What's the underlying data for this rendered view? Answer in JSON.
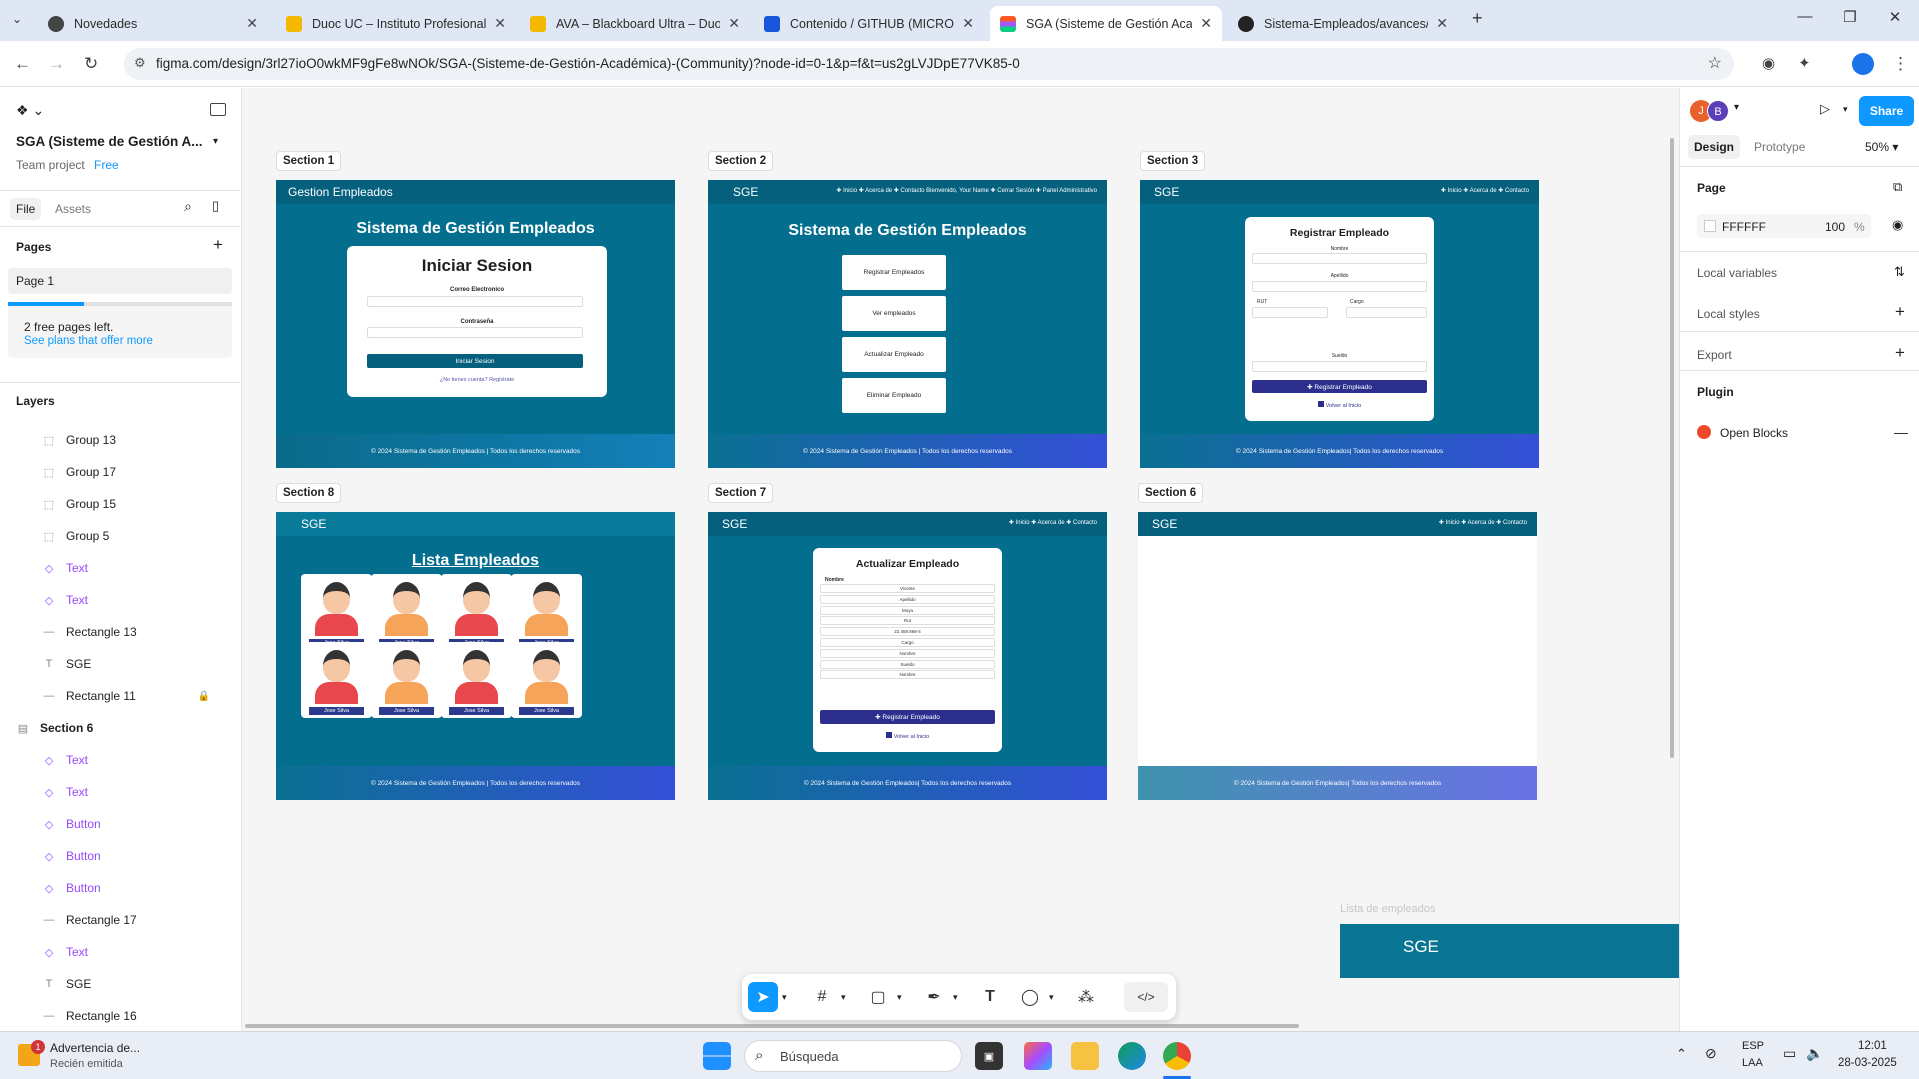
{
  "browser": {
    "tabs": [
      {
        "title": "Novedades",
        "color": "#444"
      },
      {
        "title": "Duoc UC – Instituto Profesional",
        "color": "#f5b800"
      },
      {
        "title": "AVA – Blackboard Ultra – Duoc",
        "color": "#f5b800"
      },
      {
        "title": "Contenido / GITHUB (MICROSC",
        "color": "#1a56db"
      },
      {
        "title": "SGA (Sisteme de Gestión Acad",
        "color": "#ff5722"
      },
      {
        "title": "Sistema-Empleados/avances/se",
        "color": "#222"
      }
    ],
    "url": "figma.com/design/3rl27ioO0wkMF9gFe8wNOk/SGA-(Sisteme-de-Gestión-Académica)-(Community)?node-id=0-1&p=f&t=us2gLVJDpE77VK85-0"
  },
  "left_panel": {
    "project_title": "SGA (Sisteme de Gestión A...",
    "team": "Team project",
    "plan": "Free",
    "tab_file": "File",
    "tab_assets": "Assets",
    "pages_label": "Pages",
    "current_page": "Page 1",
    "free_pages_note": "2 free pages left.",
    "see_plans": "See plans that offer more",
    "layers_label": "Layers",
    "layers": [
      {
        "name": "Group 13",
        "kind": "group"
      },
      {
        "name": "Group 17",
        "kind": "group"
      },
      {
        "name": "Group 15",
        "kind": "group"
      },
      {
        "name": "Group 5",
        "kind": "group"
      },
      {
        "name": "Text",
        "kind": "component"
      },
      {
        "name": "Text",
        "kind": "component"
      },
      {
        "name": "Rectangle 13",
        "kind": "rect"
      },
      {
        "name": "SGE",
        "kind": "text"
      },
      {
        "name": "Rectangle 11",
        "kind": "rect"
      },
      {
        "name": "Section 6",
        "kind": "section"
      },
      {
        "name": "Text",
        "kind": "component"
      },
      {
        "name": "Text",
        "kind": "component"
      },
      {
        "name": "Button",
        "kind": "component"
      },
      {
        "name": "Button",
        "kind": "component"
      },
      {
        "name": "Button",
        "kind": "component"
      },
      {
        "name": "Rectangle 17",
        "kind": "rect"
      },
      {
        "name": "Text",
        "kind": "component"
      },
      {
        "name": "SGE",
        "kind": "text"
      },
      {
        "name": "Rectangle 16",
        "kind": "rect"
      }
    ]
  },
  "canvas": {
    "sections": {
      "s1": "Section 1",
      "s2": "Section 2",
      "s3": "Section 3",
      "s8": "Section 8",
      "s7": "Section 7",
      "s6": "Section 6"
    },
    "footer_text": "© 2024 Sistema de Gestión Empleados | Todos los derechos reservados",
    "footer_text_b": "© 2024 Sistema de Gestión Empleados| Todos los derechos reservados",
    "brand": "SGE",
    "nav_short": "✚ Inicio   ✚ Acerca de   ✚ Contacto",
    "s1": {
      "header": "Gestion Empleados",
      "title": "Sistema de Gestión Empleados",
      "card_title": "Iniciar Sesion",
      "email_label": "Correo Electronico",
      "password_label": "Contraseña",
      "login_button": "Iniciar Sesion",
      "register_link": "¿No tienes cuenta? Registrate"
    },
    "s2": {
      "nav": "✚ Inicio   ✚ Acerca de   ✚ Contacto     Bienvenido, Your Name     ✚ Cerrar Sesión     ✚ Panel Administrativo",
      "title": "Sistema de Gestión Empleados",
      "buttons": [
        "Registrar Empleados",
        "Ver empleados",
        "Actualizar Empleado",
        "Eliminar Empleado"
      ]
    },
    "s3": {
      "card_title": "Registrar Empleado",
      "f_nombre": "Nombre",
      "f_apellido": "Apellido",
      "f_rut": "RUT",
      "f_cargo": "Cargo",
      "f_sueldo": "Sueldo",
      "submit": "✚ Registrar Empleado",
      "back": "Volver al Inicio"
    },
    "s8": {
      "title": "Lista Empleados",
      "employee_name": "Jose Silva"
    },
    "s7": {
      "card_title": "Actualizar Empleado",
      "label": "Nombre",
      "fields": [
        "Vicente",
        "Apellido",
        "Moya",
        "Rut",
        "22.459.868-4",
        "Cargo",
        "Nombre",
        "Sueldo",
        "Nombre"
      ],
      "submit": "✚ Registrar Empleado",
      "back": "Volver al Inicio"
    },
    "floating_label": "Lista de empleados",
    "floating_brand": "SGE"
  },
  "right_panel": {
    "avatars": [
      "J",
      "B"
    ],
    "avatar_colors": [
      "#e8612c",
      "#5b3fb8"
    ],
    "share": "Share",
    "tab_design": "Design",
    "tab_prototype": "Prototype",
    "zoom": "50%",
    "page_label": "Page",
    "page_color": "FFFFFF",
    "opacity": "100",
    "opacity_unit": "%",
    "local_variables": "Local variables",
    "local_styles": "Local styles",
    "export": "Export",
    "plugin": "Plugin",
    "plugin_name": "Open Blocks"
  },
  "taskbar": {
    "notif_title": "Advertencia de...",
    "notif_sub": "Recién emitida",
    "notif_badge": "1",
    "search": "Búsqueda",
    "lang": "ESP",
    "region": "LAA",
    "time": "12:01",
    "date": "28-03-2025"
  }
}
